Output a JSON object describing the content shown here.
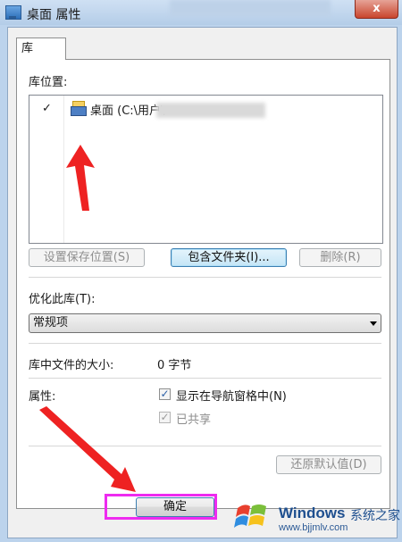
{
  "window": {
    "title": "桌面 属性",
    "close_label": "x"
  },
  "tabs": [
    {
      "label": "库"
    }
  ],
  "library_locations": {
    "heading": "库位置:",
    "items": [
      {
        "checked": "✓",
        "label": "桌面 (C:\\用户\\"
      }
    ]
  },
  "buttons": {
    "set_save_location": "设置保存位置(S)",
    "include_folder": "包含文件夹(I)...",
    "remove": "删除(R)",
    "restore_defaults": "还原默认值(D)",
    "ok": "确定"
  },
  "optimize": {
    "label": "优化此库(T):",
    "selected": "常规项"
  },
  "size": {
    "label": "库中文件的大小:",
    "value": "0 字节"
  },
  "attributes": {
    "label": "属性:",
    "show_in_nav": {
      "label": "显示在导航窗格中(N)",
      "checked": "✓"
    },
    "shared": {
      "label": "已共享",
      "checked": "✓"
    }
  },
  "watermark": {
    "brand": "Windows",
    "chinese": "系统之家",
    "url": "www.bjjmlv.com"
  },
  "colors": {
    "arrow": "#ee2222",
    "highlight": "#ee2bf0"
  }
}
